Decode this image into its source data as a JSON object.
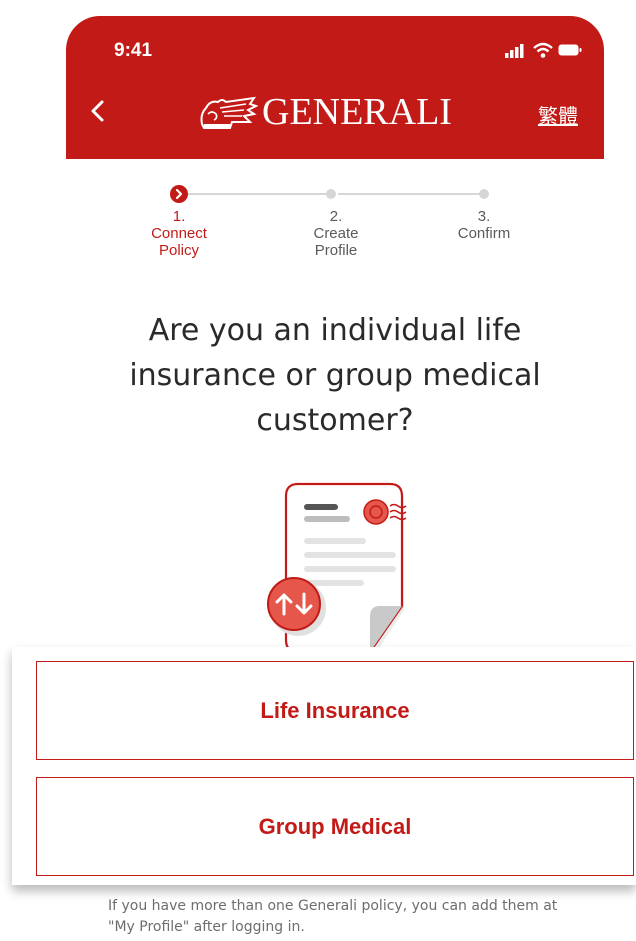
{
  "status_bar": {
    "time": "9:41"
  },
  "header": {
    "brand": "GENERALI",
    "language_link": "繁體",
    "colors": {
      "brand_red": "#c21b17"
    }
  },
  "stepper": {
    "steps": [
      {
        "number": "1.",
        "label_line1": "Connect",
        "label_line2": "Policy",
        "state": "active"
      },
      {
        "number": "2.",
        "label_line1": "Create",
        "label_line2": "Profile",
        "state": "inactive"
      },
      {
        "number": "3.",
        "label_line1": "Confirm",
        "label_line2": "",
        "state": "inactive"
      }
    ]
  },
  "question": {
    "line1": "Are you an individual life",
    "line2": "insurance or group medical",
    "line3": "customer?"
  },
  "options": {
    "life_insurance": "Life Insurance",
    "group_medical": "Group Medical"
  },
  "footnote": "If you have more than one Generali policy, you can add them at \"My Profile\" after logging in.",
  "icons": [
    "back-icon",
    "signal-icon",
    "wifi-icon",
    "battery-icon",
    "generali-lion-logo-icon",
    "chevron-right-icon",
    "policy-document-illustration",
    "transfer-arrows-icon"
  ]
}
